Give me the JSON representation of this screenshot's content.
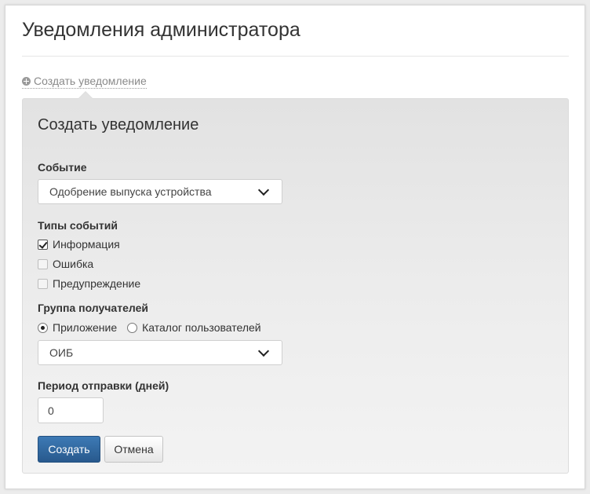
{
  "page": {
    "title": "Уведомления администратора",
    "toggle_link": "Создать уведомление"
  },
  "form": {
    "title": "Создать уведомление",
    "event": {
      "label": "Событие",
      "selected": "Одобрение выпуска устройства",
      "icon": "chevron-down-icon"
    },
    "event_types": {
      "label": "Типы событий",
      "options": [
        {
          "label": "Информация",
          "checked": true
        },
        {
          "label": "Ошибка",
          "checked": false
        },
        {
          "label": "Предупреждение",
          "checked": false
        }
      ]
    },
    "recipients": {
      "label": "Группа получателей",
      "options": [
        {
          "label": "Приложение",
          "checked": true
        },
        {
          "label": "Каталог пользователей",
          "checked": false
        }
      ],
      "selected": "ОИБ",
      "icon": "chevron-down-icon"
    },
    "period": {
      "label": "Период отправки (дней)",
      "value": "0"
    },
    "buttons": {
      "create": "Создать",
      "cancel": "Отмена"
    }
  },
  "colors": {
    "primary_button": "#2f6aa3",
    "panel_bg": "#ececec",
    "link": "#8a8a8a"
  }
}
